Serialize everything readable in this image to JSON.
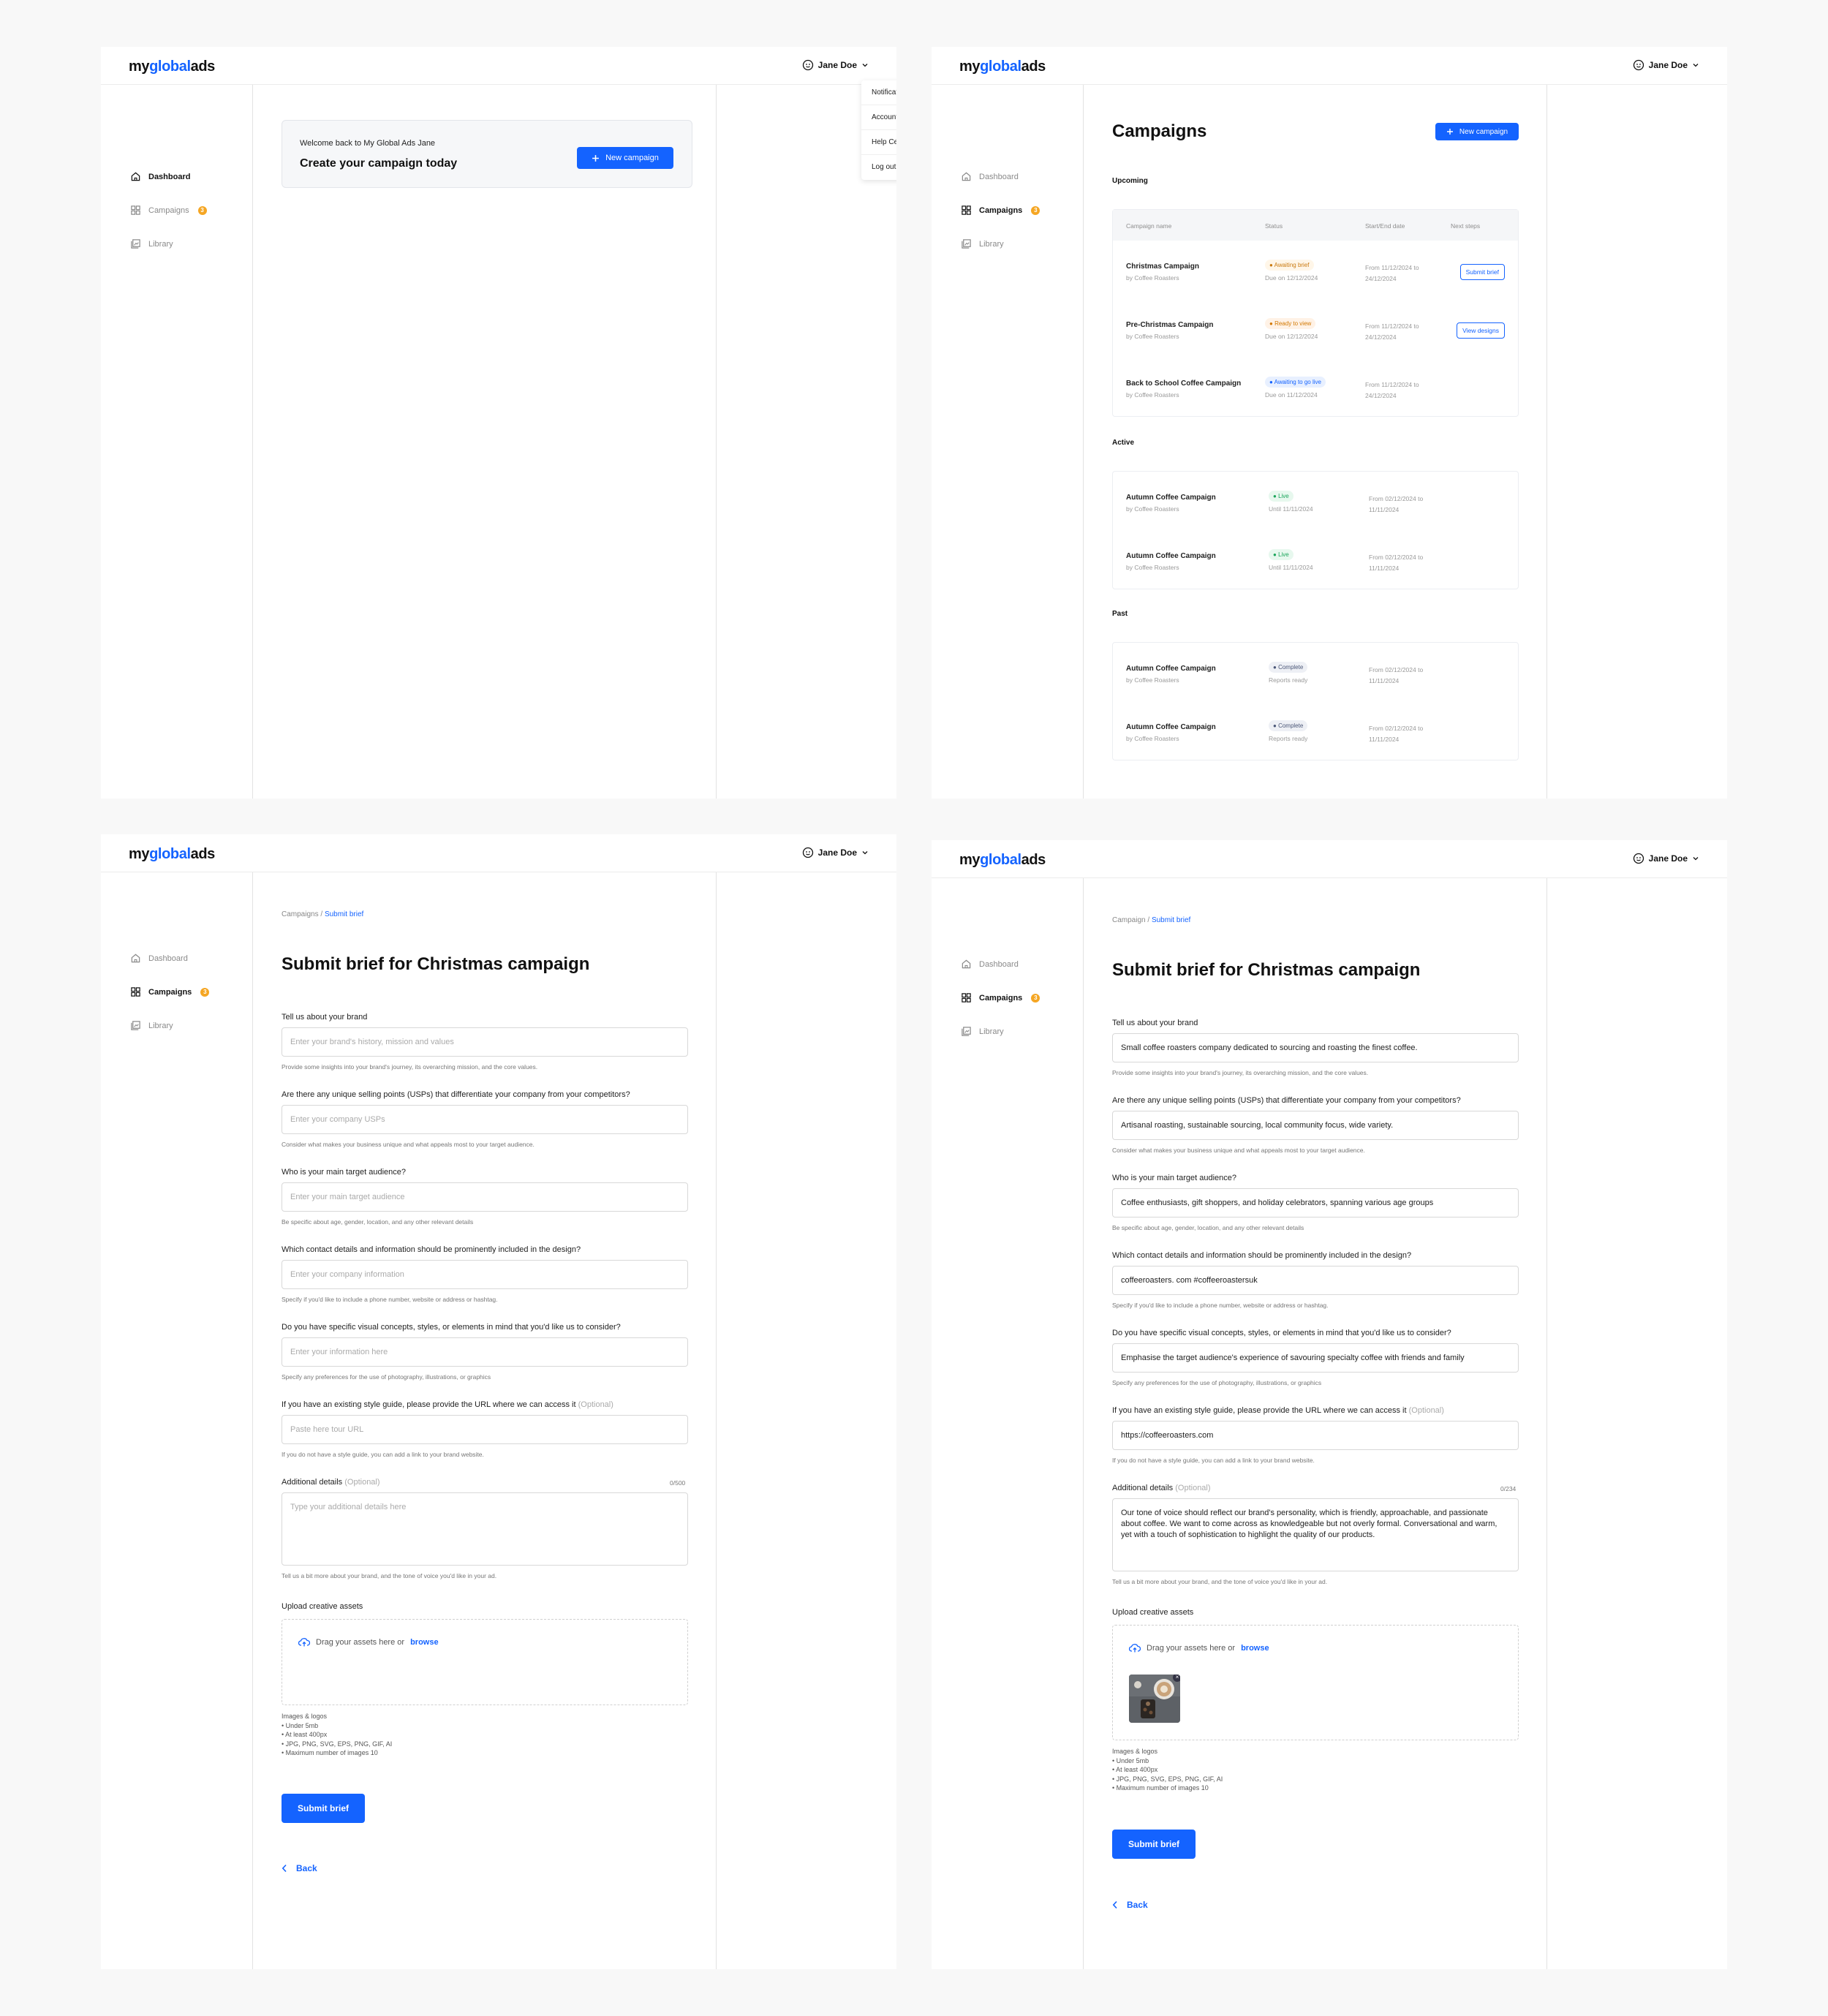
{
  "brand": {
    "logo_prefix": "my",
    "logo_mid": "global",
    "logo_suffix": "ads"
  },
  "user": {
    "name": "Jane Doe"
  },
  "nav": {
    "dashboard": "Dashboard",
    "campaigns": "Campaigns",
    "campaigns_badge": "3",
    "library": "Library"
  },
  "dropdown": [
    "Notifications",
    "Account",
    "Help Centre",
    "Log out"
  ],
  "dashboard": {
    "welcome": "Welcome back to My Global Ads Jane",
    "title": "Create your campaign today",
    "new_campaign": "New campaign"
  },
  "campaigns": {
    "title": "Campaigns",
    "new_campaign": "New campaign",
    "upcoming_label": "Upcoming",
    "active_label": "Active",
    "past_label": "Past",
    "headers": [
      "Campaign name",
      "Status",
      "Start/End date",
      "Next steps"
    ],
    "upcoming": [
      {
        "name": "Christmas Campaign",
        "by": "by Coffee Roasters",
        "status": "Awaiting brief",
        "due": "Due on 12/12/2024",
        "dates": "From 11/12/2024 to 24/12/2024",
        "action": "Submit brief"
      },
      {
        "name": "Pre-Christmas Campaign",
        "by": "by Coffee Roasters",
        "status": "Ready to view",
        "due": "Due on 12/12/2024",
        "dates": "From 11/12/2024 to 24/12/2024",
        "action": "View designs"
      },
      {
        "name": "Back to School Coffee Campaign",
        "by": "by Coffee Roasters",
        "status": "Awaiting to go live",
        "due": "Due on 11/12/2024",
        "dates": "From 11/12/2024 to 24/12/2024",
        "action": ""
      }
    ],
    "active": [
      {
        "name": "Autumn Coffee Campaign",
        "by": "by Coffee Roasters",
        "status": "Live",
        "due": "Until 11/11/2024",
        "dates": "From 02/12/2024 to 11/11/2024"
      },
      {
        "name": "Autumn Coffee Campaign",
        "by": "by Coffee Roasters",
        "status": "Live",
        "due": "Until 11/11/2024",
        "dates": "From 02/12/2024 to 11/11/2024"
      }
    ],
    "past": [
      {
        "name": "Autumn Coffee Campaign",
        "by": "by Coffee Roasters",
        "status": "Complete",
        "due": "Reports ready",
        "dates": "From 02/12/2024 to 11/11/2024"
      },
      {
        "name": "Autumn Coffee Campaign",
        "by": "by Coffee Roasters",
        "status": "Complete",
        "due": "Reports ready",
        "dates": "From 02/12/2024 to 11/11/2024"
      }
    ]
  },
  "brief_empty": {
    "crumb_parent": "Campaigns",
    "crumb_sep": "/",
    "crumb_current": "Submit brief",
    "title": "Submit brief for Christmas campaign",
    "fields": [
      {
        "label": "Tell us about your brand",
        "placeholder": "Enter your brand's history, mission and values",
        "help": "Provide some insights into your brand's journey, its overarching mission, and the core values."
      },
      {
        "label": "Are there any unique selling points (USPs) that differentiate your company from your competitors?",
        "placeholder": "Enter your company USPs",
        "help": "Consider what makes your business unique and what appeals most to your target audience."
      },
      {
        "label": "Who is your main target audience?",
        "placeholder": "Enter your main target audience",
        "help": "Be specific about age, gender, location, and any other relevant details"
      },
      {
        "label": "Which contact details and information should be prominently included in the design?",
        "placeholder": "Enter your company information",
        "help": "Specify if you'd like to include a phone number, website or address or hashtag."
      },
      {
        "label": "Do you have specific visual concepts, styles, or elements in mind that you'd like us to consider?",
        "placeholder": "Enter your information here",
        "help": "Specify any preferences for the use of photography, illustrations, or graphics"
      },
      {
        "label": "If you have an existing style guide, please provide the URL where we can access it",
        "optional": "(Optional)",
        "placeholder": "Paste here tour URL",
        "help": "If you do not have a style guide, you can add a link to your brand website."
      }
    ],
    "additional_label": "Additional details",
    "additional_optional": "(Optional)",
    "additional_counter": "0/500",
    "additional_placeholder": "Type your additional details here",
    "additional_help": "Tell us a bit more about your brand, and the tone of voice you'd like in your ad.",
    "upload_label": "Upload creative assets",
    "upload_drag": "Drag your assets here or",
    "upload_browse": "browse",
    "reqs_title": "Images & logos",
    "reqs": [
      "Under 5mb",
      "At least 400px",
      "JPG, PNG, SVG, EPS, PNG, GIF, AI",
      "Maximum number of images 10"
    ],
    "submit": "Submit brief",
    "back": "Back"
  },
  "brief_filled": {
    "crumb_parent": "Campaign",
    "crumb_sep": "/",
    "crumb_current": "Submit brief",
    "title": "Submit brief for Christmas campaign",
    "fields": [
      {
        "label": "Tell us about your brand",
        "value": "Small coffee roasters company dedicated to sourcing and roasting the finest coffee.",
        "help": "Provide some insights into your brand's journey, its overarching mission, and the core values."
      },
      {
        "label": "Are there any unique selling points (USPs) that differentiate your company from your competitors?",
        "value": "Artisanal roasting, sustainable sourcing, local community focus, wide variety.",
        "help": "Consider what makes your business unique and what appeals most to your target audience."
      },
      {
        "label": "Who is your main target audience?",
        "value": "Coffee enthusiasts, gift shoppers, and holiday celebrators, spanning various age groups",
        "help": "Be specific about age, gender, location, and any other relevant details"
      },
      {
        "label": "Which contact details and information should be prominently included in the design?",
        "value": "coffeeroasters. com  #coffeeroastersuk",
        "help": "Specify if you'd like to include a phone number, website or address or hashtag."
      },
      {
        "label": "Do you have specific visual concepts, styles, or elements in mind that you'd like us to consider?",
        "value": "Emphasise the target audience's experience of savouring specialty coffee with friends and family",
        "help": "Specify any preferences for the use of photography, illustrations, or graphics"
      },
      {
        "label": "If you have an existing style guide, please provide the URL where we can access it",
        "optional": "(Optional)",
        "value": "https://coffeeroasters.com",
        "help": "If you do not have a style guide, you can add a link to your brand website."
      }
    ],
    "additional_label": "Additional details",
    "additional_optional": "(Optional)",
    "additional_counter": "0/234",
    "additional_value": "Our tone of voice should reflect our brand's personality, which is friendly, approachable, and passionate about coffee. We want to come across as knowledgeable but not overly formal. Conversational and warm, yet with a touch of sophistication to highlight the quality of our products.",
    "additional_help": "Tell us a bit more about your brand, and the tone of voice you'd like in your ad.",
    "upload_label": "Upload creative assets",
    "upload_drag": "Drag your assets here or",
    "upload_browse": "browse",
    "reqs_title": "Images & logos",
    "reqs": [
      "Under 5mb",
      "At least 400px",
      "JPG, PNG, SVG, EPS, PNG, GIF, AI",
      "Maximum number of images 10"
    ],
    "submit": "Submit brief",
    "back": "Back"
  },
  "colors": {
    "accent": "#1463ff",
    "badge": "#f5a623",
    "live": "#1aa55a",
    "awaiting": "#c97a10"
  },
  "icons": [
    "home-icon",
    "grid-icon",
    "library-icon",
    "smiley-icon",
    "chevron-down-icon",
    "plus-icon",
    "cloud-upload-icon",
    "chevron-left-icon",
    "close-icon"
  ]
}
